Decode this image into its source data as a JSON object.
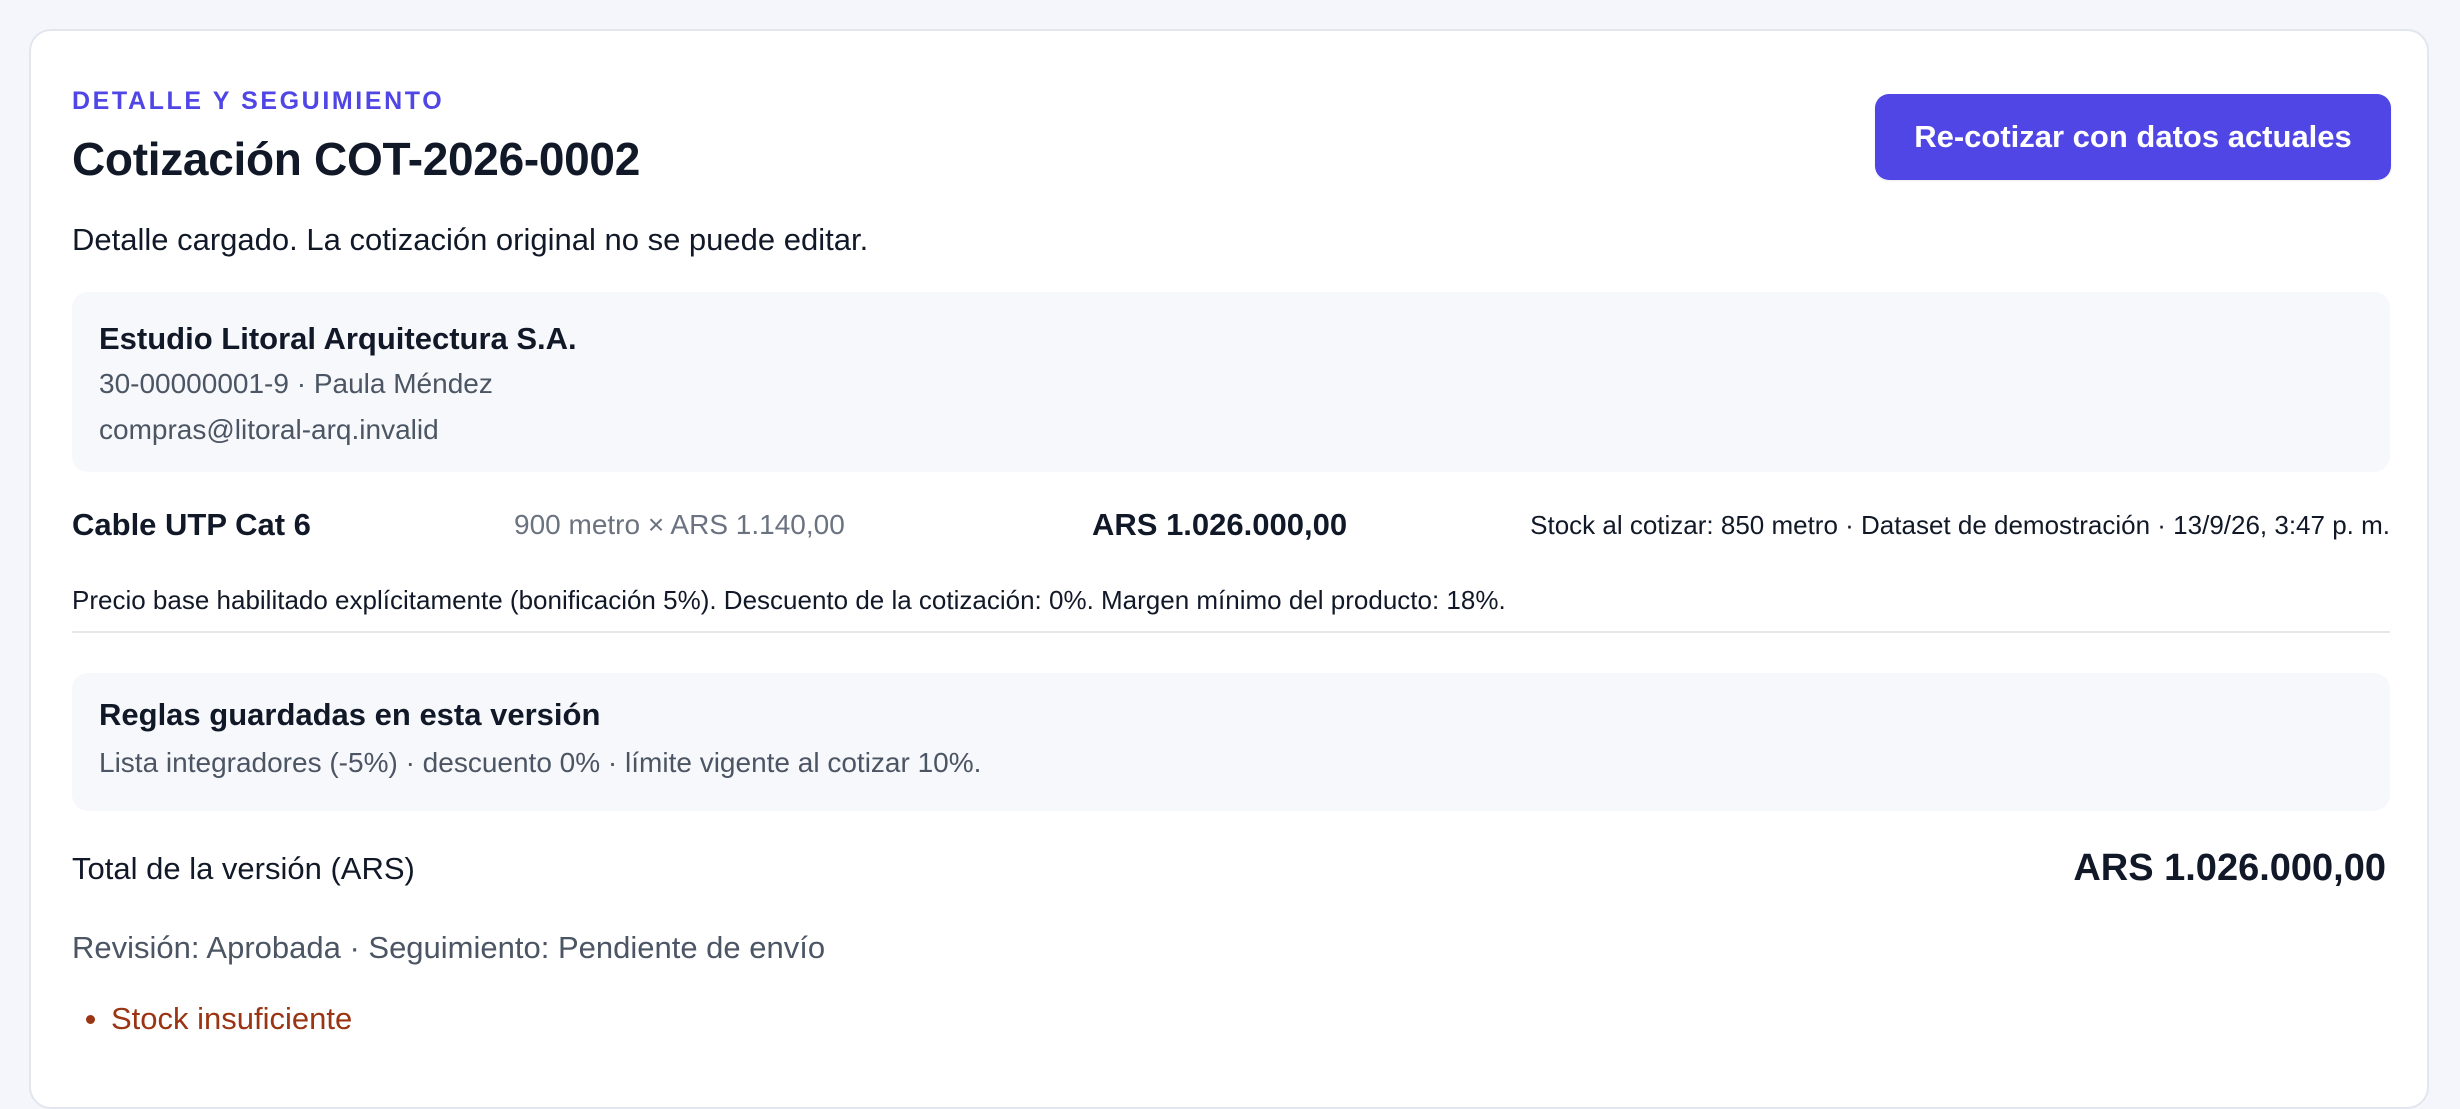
{
  "header": {
    "eyebrow": "DETALLE Y SEGUIMIENTO",
    "title": "Cotización COT-2026-0002",
    "recotizar_label": "Re-cotizar con datos actuales"
  },
  "status_message": "Detalle cargado. La cotización original no se puede editar.",
  "client": {
    "name": "Estudio Litoral Arquitectura S.A.",
    "tax_and_contact": "30-00000001-9 · Paula Méndez",
    "email": "compras@litoral-arq.invalid"
  },
  "items": [
    {
      "name": "Cable UTP Cat 6",
      "quantity_price": "900 metro × ARS 1.140,00",
      "line_total": "ARS 1.026.000,00",
      "stock_info": "Stock al cotizar: 850 metro · Dataset de demostración · 13/9/26, 3:47 p. m.",
      "price_note": "Precio base habilitado explícitamente (bonificación 5%). Descuento de la cotización: 0%. Margen mínimo del producto: 18%."
    }
  ],
  "rules": {
    "title": "Reglas guardadas en esta versión",
    "detail": "Lista integradores (-5%) · descuento 0% · límite vigente al cotizar 10%."
  },
  "total": {
    "label": "Total de la versión (ARS)",
    "value": "ARS 1.026.000,00"
  },
  "review_status": "Revisión: Aprobada · Seguimiento: Pendiente de envío",
  "warnings": [
    "Stock insuficiente"
  ],
  "colors": {
    "accent": "#4f46e5",
    "warning": "#9a3412",
    "muted_text": "#4b5563",
    "panel_bg": "#f7f8fb"
  }
}
